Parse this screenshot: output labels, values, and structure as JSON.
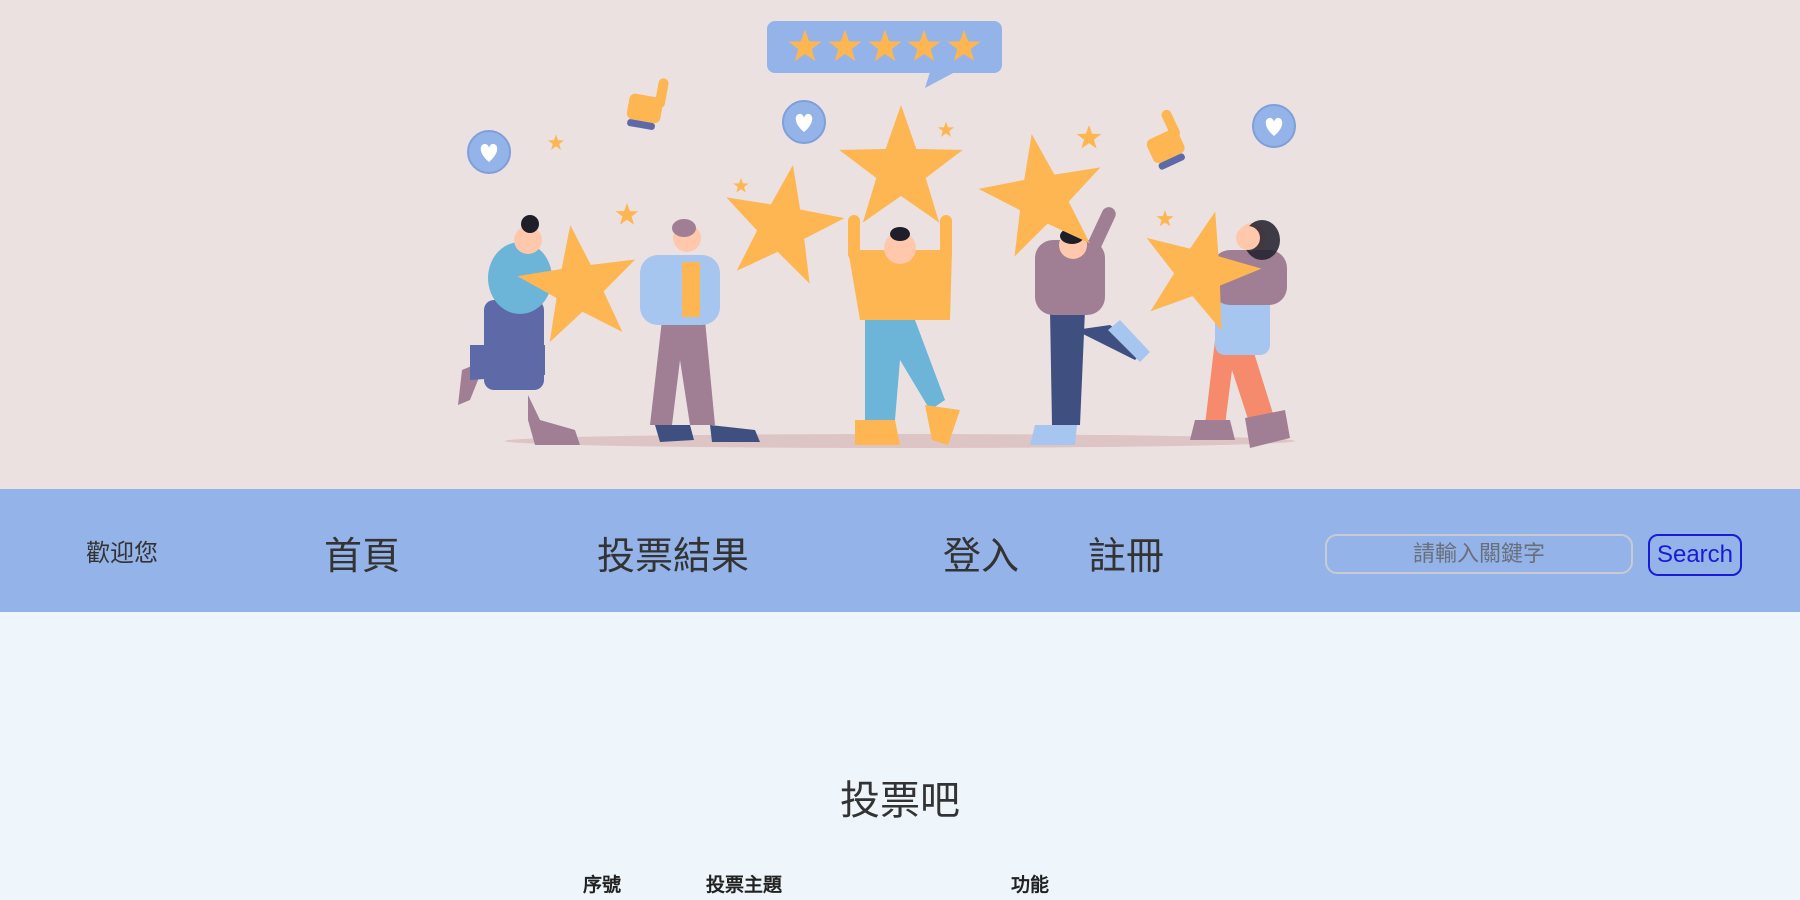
{
  "nav": {
    "welcome": "歡迎您",
    "home": "首頁",
    "results": "投票結果",
    "login": "登入",
    "register": "註冊"
  },
  "search": {
    "placeholder": "請輸入關鍵字",
    "button": "Search"
  },
  "main": {
    "title": "投票吧",
    "columns": [
      "序號",
      "投票主題",
      "功能"
    ]
  },
  "hero": {
    "rating_stars": 5,
    "colors": {
      "background": "#ece1e1",
      "star": "#fdb652",
      "bubble": "#94b3e8",
      "nav": "#94b3e8"
    }
  }
}
